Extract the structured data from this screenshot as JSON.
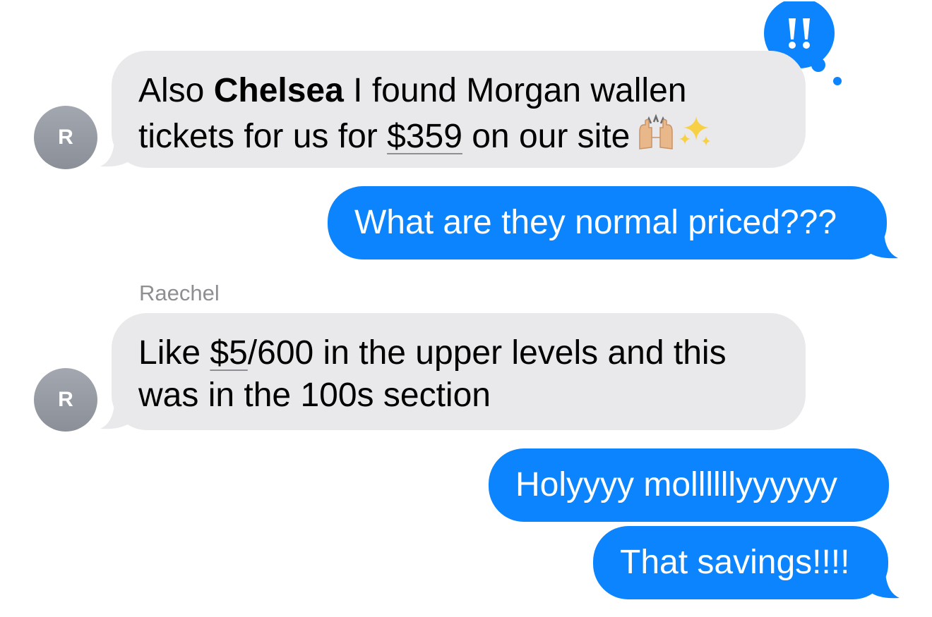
{
  "messages": [
    {
      "from": "received",
      "avatar_initial": "R",
      "text_before": "Also ",
      "text_bold": "Chelsea",
      "text_middle": " I found Morgan wallen tickets for us for ",
      "text_link": "$359",
      "text_after": " on our site",
      "emoji": [
        "raising-hands-icon",
        "sparkles-icon"
      ],
      "tapback": "!!"
    },
    {
      "from": "sent",
      "text": "What are they normal priced???"
    },
    {
      "from": "received",
      "sender_name": "Raechel",
      "avatar_initial": "R",
      "text_before": "Like ",
      "text_link": "$5",
      "text_after": "/600 in the upper levels and this was in the 100s section"
    },
    {
      "from": "sent",
      "text": "Holyyyy mollllllyyyyyy"
    },
    {
      "from": "sent",
      "text": "That savings!!!!"
    }
  ],
  "colors": {
    "sent_bubble": "#0b84fe",
    "received_bubble": "#e9e9eb",
    "avatar": "#9a9ea7",
    "sender_name": "#8e8e93"
  }
}
